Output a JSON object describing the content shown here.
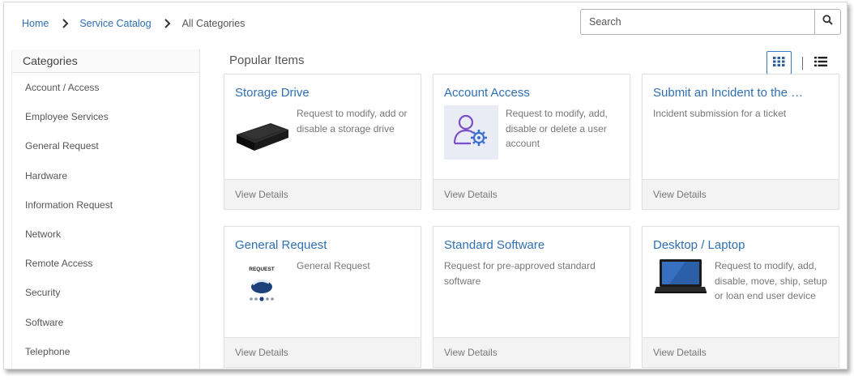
{
  "breadcrumb": {
    "home": "Home",
    "service_catalog": "Service Catalog",
    "current": "All Categories"
  },
  "search": {
    "placeholder": "Search",
    "value": "",
    "icon": "search-icon"
  },
  "sidebar": {
    "title": "Categories",
    "items": [
      "Account / Access",
      "Employee Services",
      "General Request",
      "Hardware",
      "Information Request",
      "Network",
      "Remote Access",
      "Security",
      "Software",
      "Telephone"
    ]
  },
  "main": {
    "section_title": "Popular Items",
    "view_toggle": {
      "active": "grid",
      "grid_icon": "grid-view-icon",
      "list_icon": "list-view-icon"
    },
    "cards": [
      {
        "title": "Storage Drive",
        "description": "Request to modify, add or disable a storage drive",
        "image": "storage-drive-image",
        "footer": "View Details"
      },
      {
        "title": "Account Access",
        "description": "Request to modify, add, disable or delete a user account",
        "image": "user-gear-image",
        "footer": "View Details"
      },
      {
        "title": "Submit an Incident to the …",
        "description": "Incident submission for a ticket",
        "image": "",
        "footer": "View Details"
      },
      {
        "title": "General Request",
        "description": "General Request",
        "image": "request-form-image",
        "footer": "View Details",
        "image_text": "REQUEST"
      },
      {
        "title": "Standard Software",
        "description": "Request for pre-approved standard software",
        "image": "",
        "footer": "View Details"
      },
      {
        "title": "Desktop / Laptop",
        "description": "Request to modify, add, disable, move, ship, setup or loan end user device",
        "image": "laptop-image",
        "footer": "View Details"
      }
    ]
  },
  "colors": {
    "link": "#2f6fb3",
    "accent": "#3a78c2",
    "footer_bg": "#f3f3f3"
  }
}
